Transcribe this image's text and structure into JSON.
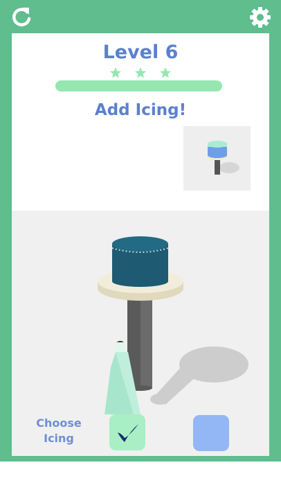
{
  "header": {
    "restart_icon": "restart-icon",
    "settings_icon": "gear-icon"
  },
  "level": {
    "title": "Level 6",
    "stars_total": 3,
    "progress": 1.0
  },
  "instruction": "Add Icing!",
  "preview": {
    "icon": "cake-preview"
  },
  "controls": {
    "choose_line1": "Choose",
    "choose_line2": "Icing",
    "options": [
      {
        "name": "mint",
        "selected": true,
        "color": "#a9efc5"
      },
      {
        "name": "blue",
        "selected": false,
        "color": "#93b6f5"
      }
    ]
  },
  "colors": {
    "frame": "#5fbd8e",
    "accent_text": "#5b80cf",
    "progress": "#95e7b0",
    "cake": "#1e5b72"
  }
}
